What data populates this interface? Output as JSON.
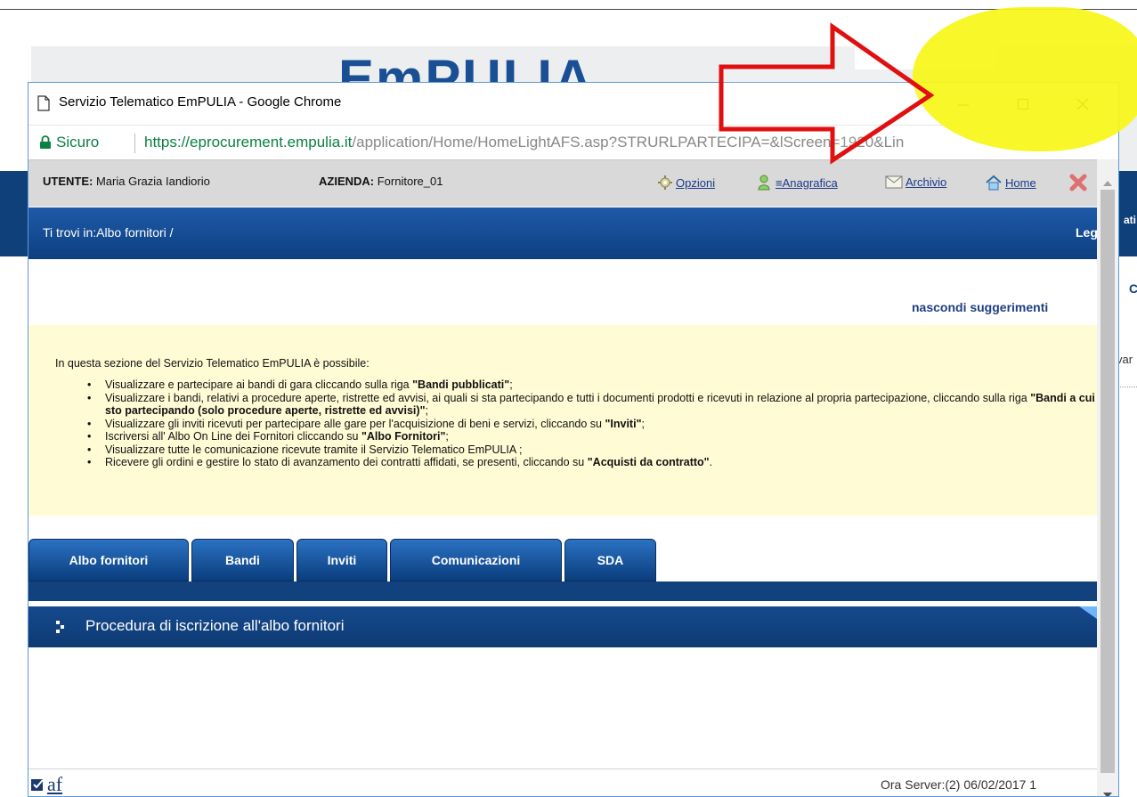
{
  "background": {
    "logo_text": "EmPULIA",
    "right_edge_texts": [
      "ati",
      "C",
      "var"
    ]
  },
  "window": {
    "title": "Servizio Telematico EmPULIA - Google Chrome",
    "controls": [
      "minimize",
      "maximize",
      "close"
    ]
  },
  "address_bar": {
    "secure_label": "Sicuro",
    "url_scheme": "https://",
    "url_domain": "eprocurement.empulia.it",
    "url_path": "/application/Home/HomeLightAFS.asp?STRURLPARTECIPA=&lScreen=1920&Lin"
  },
  "userbar": {
    "user_label": "UTENTE:",
    "user_name": "Maria Grazia Iandiorio",
    "company_label": "AZIENDA:",
    "company_name": "Fornitore_01",
    "tools": {
      "opzioni": "Opzioni",
      "anagrafica": "≡Anagrafica",
      "archivio": "Archivio",
      "home": "Home"
    }
  },
  "breadcrumb": {
    "text": "Ti trovi in:Albo fornitori /",
    "right_text": "Leg"
  },
  "hints": {
    "toggle": "nascondi suggerimenti",
    "intro": "In questa sezione del Servizio Telematico EmPULIA è possibile:",
    "items": [
      {
        "pre": "Visualizzare e partecipare ai bandi di gara cliccando sulla riga ",
        "bold": "\"Bandi pubblicati\"",
        "post": ";"
      },
      {
        "pre": "Visualizzare i bandi, relativi a procedure aperte, ristrette ed avvisi, ai quali si sta partecipando e tutti i documenti prodotti e ricevuti in relazione al propria partecipazione, cliccando sulla riga ",
        "bold": "\"Bandi a cui sto partecipando (solo procedure aperte, ristrette ed avvisi)\"",
        "post": ";"
      },
      {
        "pre": "Visualizzare gli inviti ricevuti per partecipare alle gare per l'acquisizione di beni e servizi, cliccando su ",
        "bold": "\"Inviti\"",
        "post": ";"
      },
      {
        "pre": "Iscriversi all' Albo On Line dei Fornitori cliccando su ",
        "bold": "\"Albo Fornitori\"",
        "post": ";"
      },
      {
        "pre": "Visualizzare tutte le comunicazione ricevute tramite il Servizio Telematico EmPULIA ;",
        "bold": "",
        "post": ""
      },
      {
        "pre": "Ricevere gli ordini e gestire lo stato di avanzamento dei contratti affidati, se presenti, cliccando su ",
        "bold": "\"Acquisti da contratto\"",
        "post": "."
      }
    ]
  },
  "tabs": [
    "Albo fornitori",
    "Bandi",
    "Inviti",
    "Comunicazioni",
    "SDA"
  ],
  "section": {
    "title": "Procedura di iscrizione all'albo fornitori"
  },
  "footer": {
    "logo_text": "af",
    "server_time": "Ora Server:(2) 06/02/2017 1"
  },
  "colors": {
    "brand_blue": "#10407a",
    "highlight": "#f6f61a",
    "arrow": "#e01010",
    "hints_bg": "#fffbd4"
  },
  "icons": [
    "page-icon",
    "lock-icon",
    "gear-icon",
    "user-card-icon",
    "envelope-icon",
    "home-icon",
    "exit-icon",
    "chevron-right-icon"
  ]
}
